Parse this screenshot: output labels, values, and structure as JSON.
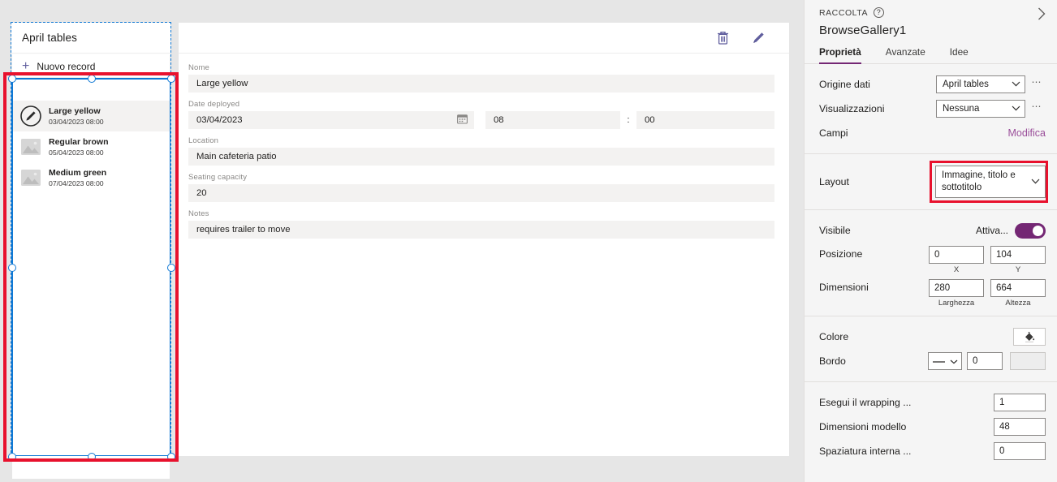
{
  "canvas": {
    "screen_title": "April tables",
    "new_record_label": "Nuovo record",
    "gallery_items": [
      {
        "title": "Large yellow",
        "subtitle": "03/04/2023 08:00",
        "thumb": "pencil-circle-icon",
        "selected": true
      },
      {
        "title": "Regular brown",
        "subtitle": "05/04/2023 08:00",
        "thumb": "image-placeholder-icon",
        "selected": false
      },
      {
        "title": "Medium green",
        "subtitle": "07/04/2023 08:00",
        "thumb": "image-placeholder-icon",
        "selected": false
      }
    ]
  },
  "form": {
    "toolbar": {
      "delete_icon": "trash-icon",
      "edit_icon": "pencil-icon"
    },
    "fields": [
      {
        "label": "Nome",
        "value": "Large yellow"
      },
      {
        "label": "Location",
        "value": "Main cafeteria patio"
      },
      {
        "label": "Seating capacity",
        "value": "20"
      },
      {
        "label": "Notes",
        "value": "requires trailer to move"
      }
    ],
    "date_field": {
      "label": "Date deployed",
      "date": "03/04/2023",
      "calendar_icon": "calendar-icon",
      "hour": "08",
      "separator": ":",
      "minute": "00"
    }
  },
  "properties": {
    "kicker": "RACCOLTA",
    "help_icon": "question-circle-icon",
    "collapse_icon": "chevron-right-icon",
    "control_name": "BrowseGallery1",
    "tabs": [
      {
        "label": "Proprietà",
        "active": true
      },
      {
        "label": "Avanzate",
        "active": false
      },
      {
        "label": "Idee",
        "active": false
      }
    ],
    "data_source": {
      "label": "Origine dati",
      "value": "April tables",
      "more_icon": "ellipsis-icon",
      "chevron": "chevron-down-icon"
    },
    "views": {
      "label": "Visualizzazioni",
      "value": "Nessuna",
      "more_icon": "ellipsis-icon",
      "chevron": "chevron-down-icon"
    },
    "fields_row": {
      "label": "Campi",
      "link": "Modifica"
    },
    "layout": {
      "label": "Layout",
      "value": "Immagine, titolo e sottotitolo",
      "chevron": "chevron-down-icon"
    },
    "visible": {
      "label": "Visibile",
      "value": "Attiva...",
      "toggle_on": true
    },
    "position": {
      "label": "Posizione",
      "x": "0",
      "y": "104",
      "x_caption": "X",
      "y_caption": "Y"
    },
    "size": {
      "label": "Dimensioni",
      "width": "280",
      "height": "664",
      "width_caption": "Larghezza",
      "height_caption": "Altezza"
    },
    "color": {
      "label": "Colore",
      "icon": "paint-bucket-icon"
    },
    "border": {
      "label": "Bordo",
      "style_icon": "line-style-icon",
      "thickness": "0",
      "color_swatch": "border-color-swatch"
    },
    "wrap_count": {
      "label": "Esegui il wrapping ...",
      "value": "1"
    },
    "template_size": {
      "label": "Dimensioni modello",
      "value": "48"
    },
    "template_padding": {
      "label": "Spaziatura interna ...",
      "value": "0"
    }
  },
  "colors": {
    "accent_purple": "#742774",
    "link_purple": "#9a4e9a",
    "selection_blue": "#0f78d4",
    "annotation_red": "#e8112d",
    "icon_blue": "#605e9e",
    "canvas_grey": "#e6e6e6",
    "panel_grey": "#f5f5f5",
    "field_grey": "#f3f2f1"
  }
}
